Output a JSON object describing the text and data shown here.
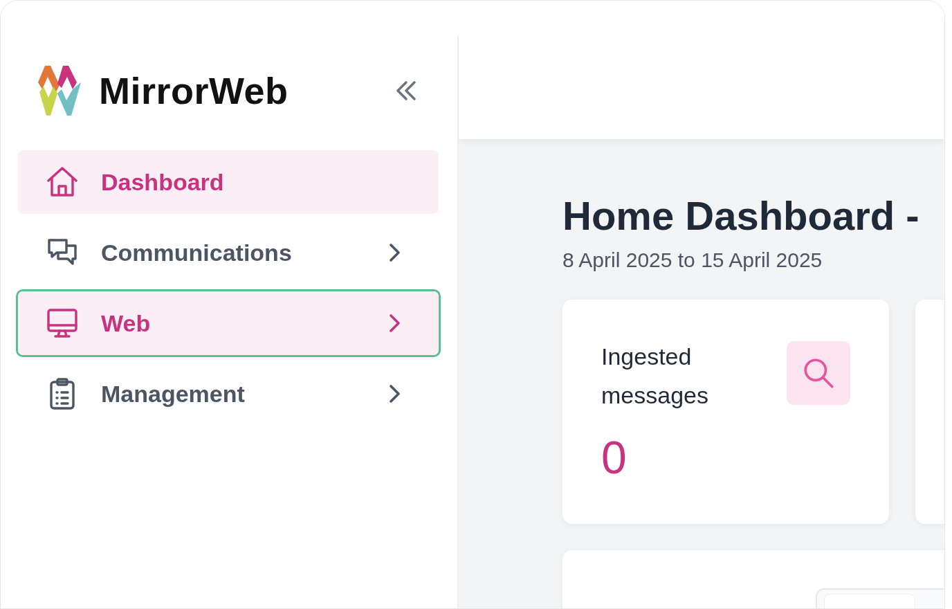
{
  "brand": {
    "name": "MirrorWeb"
  },
  "nav": [
    {
      "label": "Dashboard",
      "kind": "home",
      "selected": true,
      "focused": false,
      "submenu": false
    },
    {
      "label": "Communications",
      "kind": "chat",
      "selected": false,
      "focused": false,
      "submenu": true
    },
    {
      "label": "Web",
      "kind": "monitor",
      "selected": true,
      "focused": true,
      "submenu": true
    },
    {
      "label": "Management",
      "kind": "clipboard",
      "selected": false,
      "focused": false,
      "submenu": true
    }
  ],
  "page": {
    "title": "Home Dashboard -",
    "date_range": "8 April 2025 to 15 April 2025"
  },
  "stats": [
    {
      "label": "Ingested messages",
      "value": "0"
    }
  ]
}
